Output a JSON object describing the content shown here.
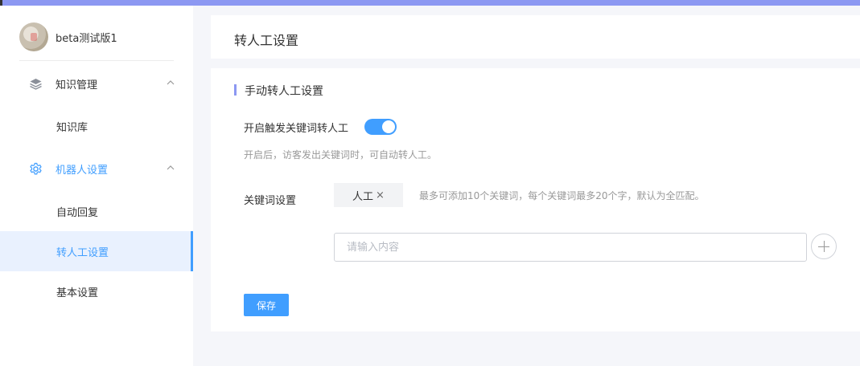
{
  "profile": {
    "name": "beta测试版1"
  },
  "sidebar": {
    "groups": [
      {
        "label": "知识管理",
        "icon": "layers-icon"
      },
      {
        "label": "机器人设置",
        "icon": "gear-icon"
      }
    ],
    "items": [
      {
        "label": "知识库"
      },
      {
        "label": "自动回复"
      },
      {
        "label": "转人工设置",
        "selected": true
      },
      {
        "label": "基本设置"
      }
    ]
  },
  "header": {
    "title": "转人工设置"
  },
  "section": {
    "title": "手动转人工设置",
    "toggle_label": "开启触发关键词转人工",
    "toggle_on": true,
    "hint": "开启后，访客发出关键词时，可自动转人工。",
    "keyword_label": "关键词设置",
    "tags": [
      "人工"
    ],
    "tag_close": "×",
    "keyword_hint": "最多可添加10个关键词，每个关键词最多20个字，默认为全匹配。",
    "input_placeholder": "请输入内容",
    "save_label": "保存"
  },
  "colors": {
    "accent": "#409eff",
    "topbar": "#8c98f2",
    "selected_bg": "#e9f1fe"
  }
}
